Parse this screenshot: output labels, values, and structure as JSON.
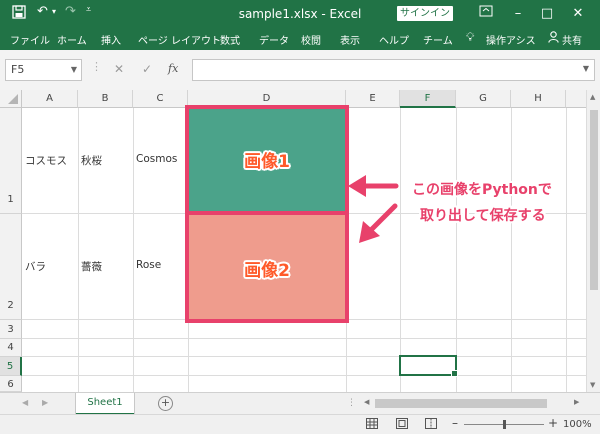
{
  "window": {
    "title": "sample1.xlsx  -  Excel",
    "signin_label": "サインイン",
    "quick_access": {
      "save": "save-icon",
      "undo": "undo-icon",
      "redo": "redo-icon"
    }
  },
  "menu": {
    "items": [
      "ファイル",
      "ホーム",
      "挿入",
      "ページ レイアウト",
      "数式",
      "データ",
      "校閲",
      "表示",
      "ヘルプ",
      "チーム"
    ],
    "tell_me": "操作アシス",
    "share": "共有"
  },
  "formula_bar": {
    "name_box": "F5",
    "fx_label": "fx",
    "value": ""
  },
  "sheet": {
    "columns": [
      "A",
      "B",
      "C",
      "D",
      "E",
      "F",
      "G",
      "H"
    ],
    "rows": [
      "1",
      "2",
      "3",
      "4",
      "5",
      "6"
    ],
    "selected_cell": "F5",
    "cells": {
      "A1": "コスモス",
      "B1": "秋桜",
      "C1": "Cosmos",
      "A2": "バラ",
      "B2": "薔薇",
      "C2": "Rose"
    },
    "images": [
      {
        "label": "画像1",
        "fill": "#4ba38a"
      },
      {
        "label": "画像2",
        "fill": "#ef9c8d"
      }
    ],
    "annotation": {
      "line1": "この画像をPythonで",
      "line2": "取り出して保存する",
      "color": "#e8416b"
    },
    "highlight_color": "#e8416b"
  },
  "tabs": {
    "active": "Sheet1"
  },
  "status": {
    "zoom": "100%"
  },
  "colors": {
    "excel_green": "#217346"
  }
}
